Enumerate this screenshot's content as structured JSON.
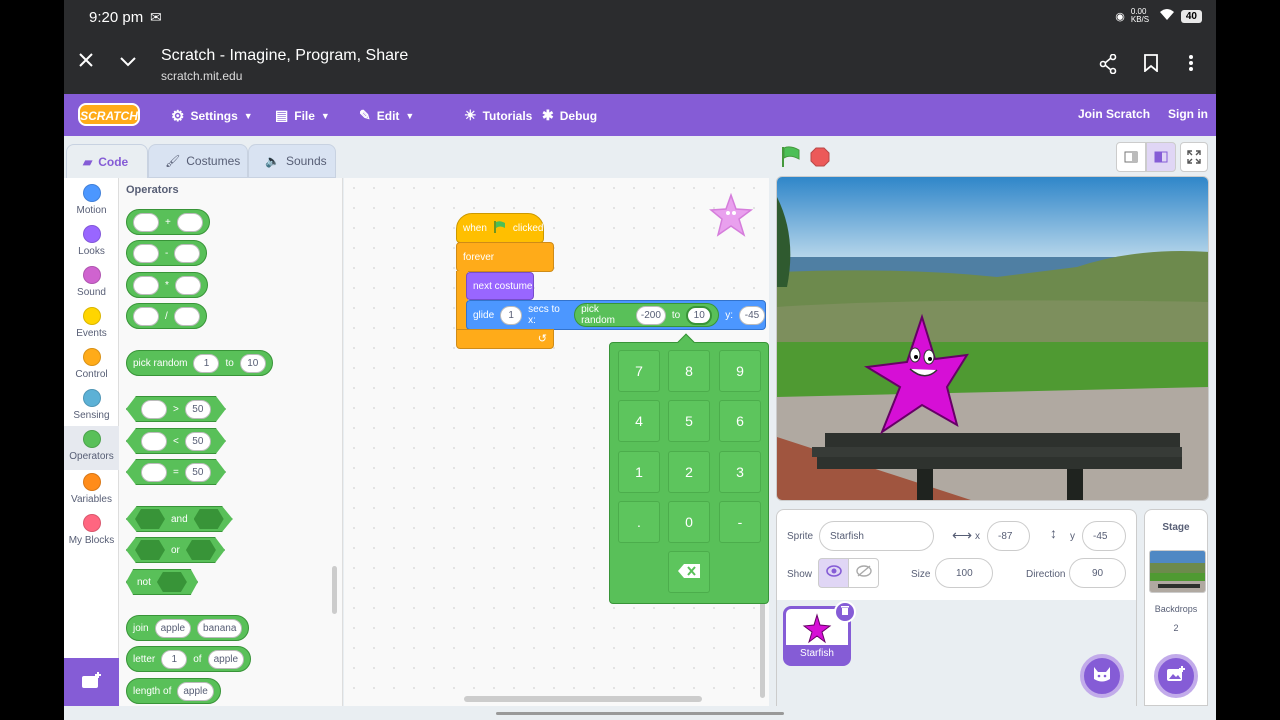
{
  "status": {
    "time": "9:20 pm",
    "speed": "0.00 KB/S",
    "battery": "40"
  },
  "browser": {
    "title": "Scratch - Imagine, Program, Share",
    "url": "scratch.mit.edu"
  },
  "menu": {
    "logo": "SCRATCH",
    "settings": "Settings",
    "file": "File",
    "edit": "Edit",
    "tutorials": "Tutorials",
    "debug": "Debug",
    "join": "Join Scratch",
    "signin": "Sign in"
  },
  "tabs": {
    "code": "Code",
    "costumes": "Costumes",
    "sounds": "Sounds"
  },
  "categories": [
    {
      "label": "Motion",
      "color": "#4c97ff"
    },
    {
      "label": "Looks",
      "color": "#9966ff"
    },
    {
      "label": "Sound",
      "color": "#cf63cf"
    },
    {
      "label": "Events",
      "color": "#ffd500"
    },
    {
      "label": "Control",
      "color": "#ffab19"
    },
    {
      "label": "Sensing",
      "color": "#5cb1d6"
    },
    {
      "label": "Operators",
      "color": "#59c059"
    },
    {
      "label": "Variables",
      "color": "#ff8c1a"
    },
    {
      "label": "My Blocks",
      "color": "#ff6680"
    }
  ],
  "palette": {
    "heading": "Operators",
    "plus": "+",
    "minus": "-",
    "times": "*",
    "divide": "/",
    "pick_random": "pick random",
    "to": "to",
    "rand_from": "1",
    "rand_to": "10",
    "gt": ">",
    "lt": "<",
    "eq": "=",
    "cmp_value": "50",
    "and": "and",
    "or": "or",
    "not": "not",
    "join": "join",
    "join_a": "apple",
    "join_b": "banana",
    "letter": "letter",
    "letter_n": "1",
    "of": "of",
    "letter_word": "apple",
    "length_of": "length of",
    "length_word": "apple"
  },
  "script": {
    "when": "when",
    "clicked": "clicked",
    "forever": "forever",
    "next_costume": "next costume",
    "glide": "glide",
    "glide_secs": "1",
    "secs_to_x": "secs to x:",
    "pick_random": "pick random",
    "rand_from": "-200",
    "to": "to",
    "rand_to": "10",
    "y_label": "y:",
    "y_value": "-45"
  },
  "keypad": {
    "keys": [
      "7",
      "8",
      "9",
      "4",
      "5",
      "6",
      "1",
      "2",
      "3",
      ".",
      "0",
      "-"
    ]
  },
  "zoom": {
    "out": "−",
    "reset": "="
  },
  "sprite": {
    "sprite_label": "Sprite",
    "name": "Starfish",
    "x_label": "x",
    "x": "-87",
    "y_label": "y",
    "y": "-45",
    "show_label": "Show",
    "size_label": "Size",
    "size": "100",
    "direction_label": "Direction",
    "direction": "90",
    "tile_name": "Starfish"
  },
  "stage_panel": {
    "title": "Stage",
    "backdrops_label": "Backdrops",
    "backdrops_count": "2"
  },
  "colors": {
    "scratch_purple": "#855cd6",
    "operators_green": "#59c059"
  }
}
